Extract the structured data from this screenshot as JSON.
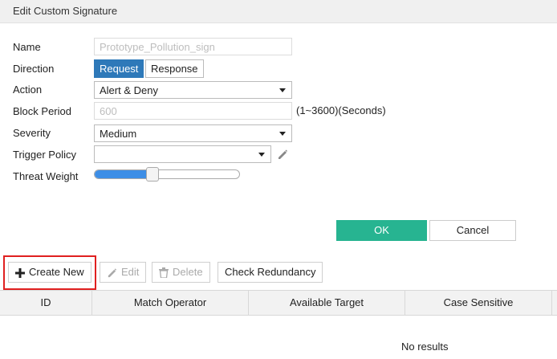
{
  "dialog": {
    "title": "Edit Custom Signature"
  },
  "form": {
    "name": {
      "label": "Name",
      "placeholder": "Prototype_Pollution_sign"
    },
    "direction": {
      "label": "Direction",
      "options": [
        "Request",
        "Response"
      ],
      "selected": "Request"
    },
    "action": {
      "label": "Action",
      "value": "Alert & Deny"
    },
    "block_period": {
      "label": "Block Period",
      "placeholder": "600",
      "unit": "(1~3600)(Seconds)"
    },
    "severity": {
      "label": "Severity",
      "value": "Medium"
    },
    "trigger_policy": {
      "label": "Trigger Policy",
      "value": ""
    },
    "threat_weight": {
      "label": "Threat Weight",
      "level_percent": 40
    }
  },
  "buttons": {
    "ok": "OK",
    "cancel": "Cancel"
  },
  "toolbar": {
    "create_new": "Create New",
    "edit": "Edit",
    "delete": "Delete",
    "check_redundancy": "Check Redundancy"
  },
  "table": {
    "columns": [
      "ID",
      "Match Operator",
      "Available Target",
      "Case Sensitive"
    ],
    "empty_text": "No results"
  },
  "colors": {
    "accent": "#2e79b9",
    "ok_button": "#27b491",
    "slider_fill": "#3d8ee6",
    "highlight": "#e02020"
  },
  "icons": {
    "edit_action": "pencil-icon",
    "create": "plus-icon",
    "delete": "trash-icon"
  }
}
